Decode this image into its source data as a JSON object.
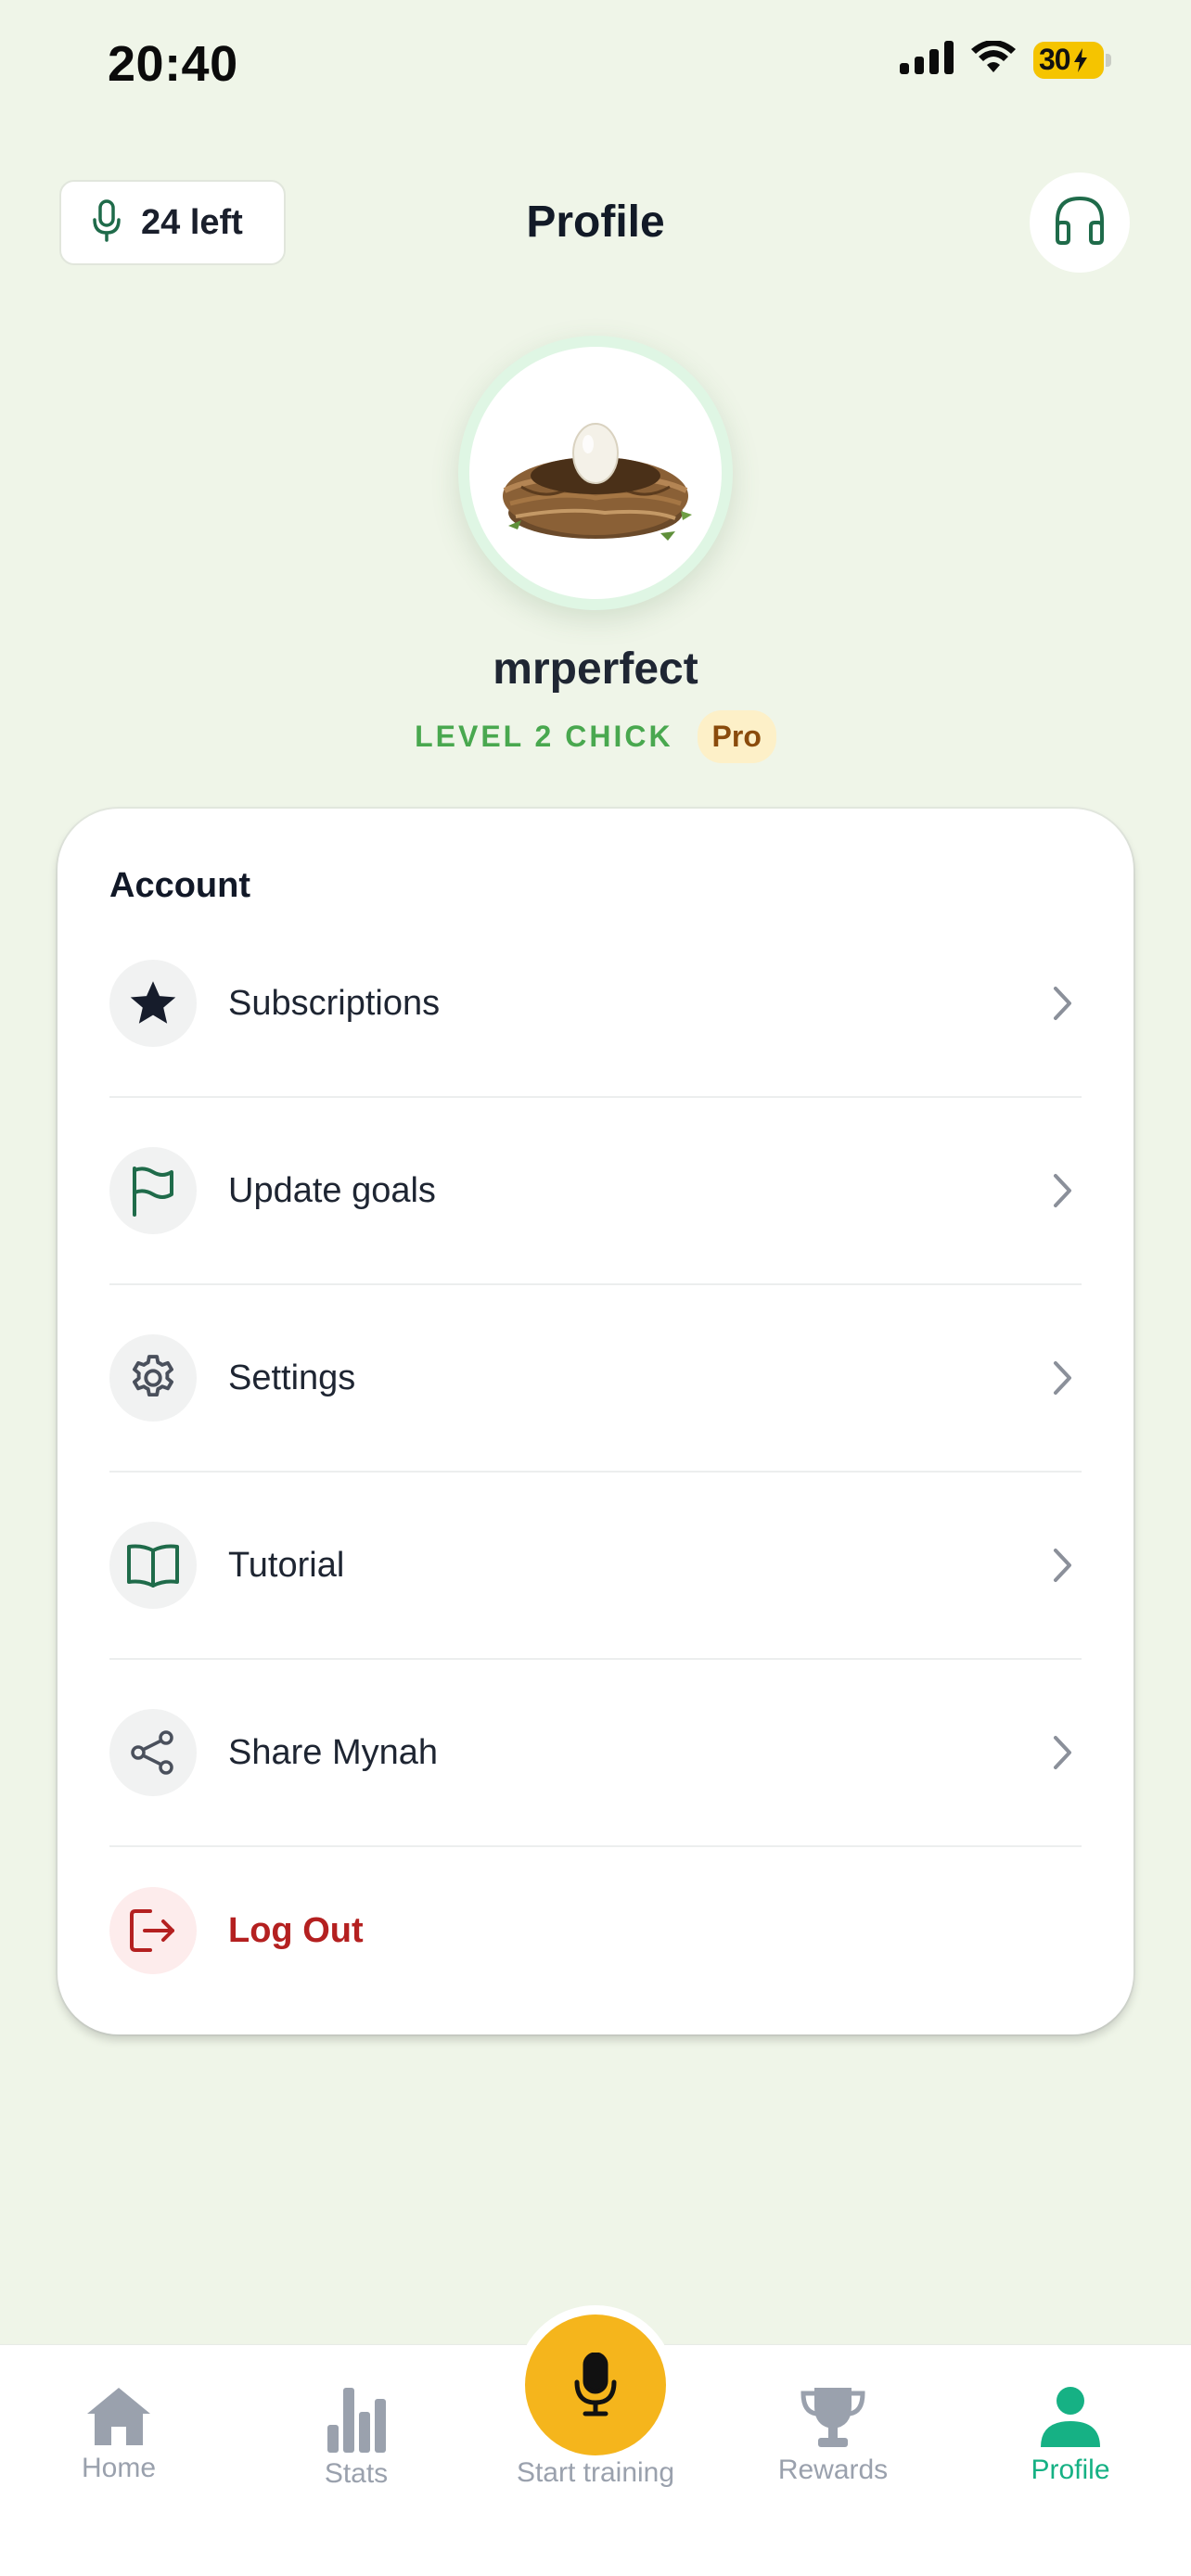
{
  "status_bar": {
    "time": "20:40",
    "battery": "30",
    "battery_level": 0.3
  },
  "header": {
    "sessions_left": "24 left",
    "title": "Profile",
    "headphones_icon": "headphones-icon"
  },
  "profile": {
    "username": "mrperfect",
    "level": "LEVEL 2 CHICK",
    "plan_badge": "Pro"
  },
  "account": {
    "title": "Account",
    "items": [
      {
        "label": "Subscriptions",
        "icon": "star-icon"
      },
      {
        "label": "Update goals",
        "icon": "flag-icon"
      },
      {
        "label": "Settings",
        "icon": "gear-icon"
      },
      {
        "label": "Tutorial",
        "icon": "book-icon"
      },
      {
        "label": "Share Mynah",
        "icon": "share-icon"
      },
      {
        "label": "Log Out",
        "icon": "logout-icon"
      }
    ]
  },
  "tabbar": {
    "home": "Home",
    "stats": "Stats",
    "start": "Start training",
    "rewards": "Rewards",
    "profile": "Profile",
    "active": "Profile"
  },
  "colors": {
    "background": "#eff5e8",
    "accent_green": "#16b184",
    "level_green": "#49a84f",
    "fab_yellow": "#f5b51c",
    "logout_red": "#b42020"
  }
}
